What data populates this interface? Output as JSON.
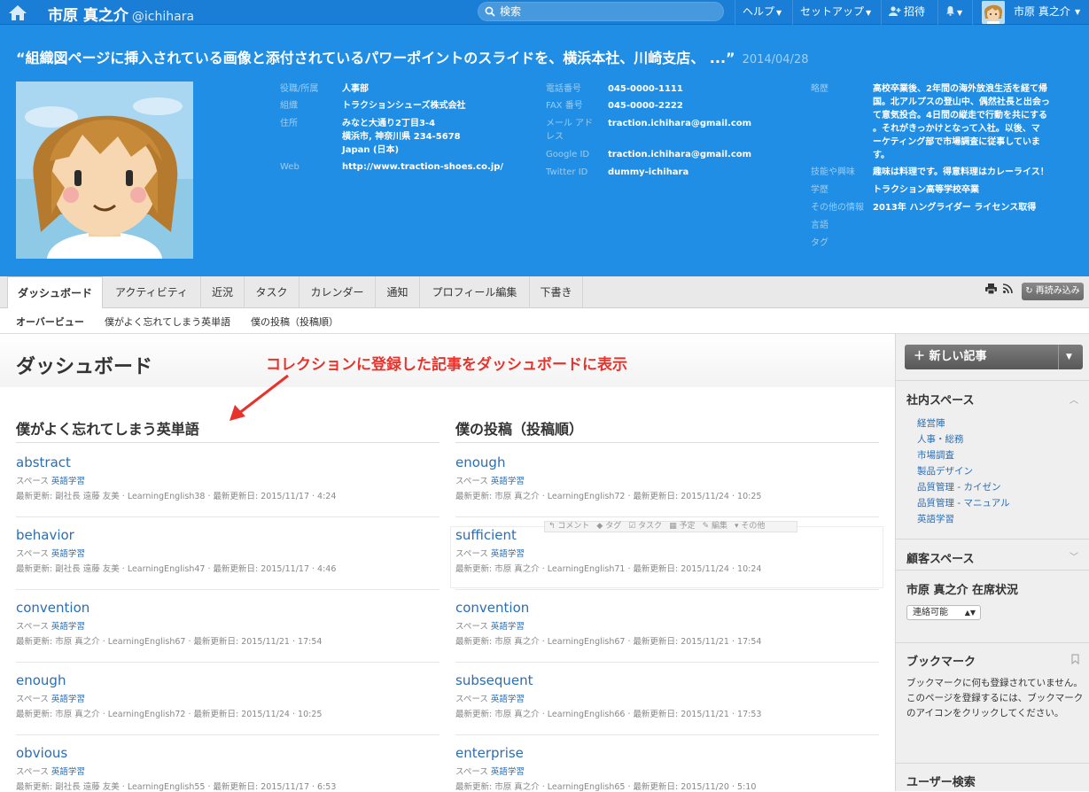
{
  "topbar": {
    "user_name": "市原 真之介",
    "user_id": "@ichihara",
    "search_placeholder": "検索",
    "menus": {
      "help": "ヘルプ",
      "setup": "セットアップ",
      "invite": "招待"
    },
    "account_name": "市原 真之介"
  },
  "hero": {
    "quote": "“組織図ページに挿入されている画像と添付されているパワーポイントのスライドを、横浜本社、川崎支店、 ...”",
    "quote_date": "2014/04/28",
    "col1": {
      "position_label": "役職/所属",
      "position_value": "人事部",
      "org_label": "組織",
      "org_value": "トラクションシューズ株式会社",
      "address_label": "住所",
      "address_line1": "みなと大通り2丁目3-4",
      "address_line2": "横浜市, 神奈川県 234-5678",
      "address_line3": "Japan (日本)",
      "web_label": "Web",
      "web_value": "http://www.traction-shoes.co.jp/"
    },
    "col2": {
      "phone_label": "電話番号",
      "phone_value": "045-0000-1111",
      "fax_label": "FAX 番号",
      "fax_value": "045-0000-2222",
      "mail_label_1": "メール アド",
      "mail_label_2": "レス",
      "mail_value": "traction.ichihara@gmail.com",
      "google_label": "Google ID",
      "google_value": "traction.ichihara@gmail.com",
      "twitter_label": "Twitter ID",
      "twitter_value": "dummy-ichihara"
    },
    "col3": {
      "bio_label": "略歴",
      "bio_lines": [
        "高校卒業後、2年間の海外放浪生活を経て帰",
        "国。北アルプスの登山中、偶然社長と出会っ",
        "て意気投合。4日間の縦走で行動を共にする",
        "。それがきっかけとなって入社。以後、マ",
        "ーケティング部で市場調査に従事していま",
        "す。"
      ],
      "skills_label": "技能や興味",
      "skills_value": "趣味は料理です。得意料理はカレーライス！",
      "edu_label": "学歴",
      "edu_value": "トラクション高等学校卒業",
      "other_label": "その他の情報",
      "other_value": "2013年 ハングライダー ライセンス取得",
      "lang_label": "言語",
      "tag_label": "タグ"
    }
  },
  "tabs": [
    "ダッシュボード",
    "アクティビティ",
    "近況",
    "タスク",
    "カレンダー",
    "通知",
    "プロフィール編集",
    "下書き"
  ],
  "reload_label": "再読み込み",
  "subnav": [
    "オーバービュー",
    "僕がよく忘れてしまう英単語",
    "僕の投稿（投稿順）"
  ],
  "main": {
    "title": "ダッシュボード",
    "annotation": "コレクションに登録した記事をダッシュボードに表示",
    "left_title": "僕がよく忘れてしまう英単語",
    "right_title": "僕の投稿（投稿順）",
    "space_prefix": "スペース",
    "left_articles": [
      {
        "title": "abstract",
        "space": "英語学習",
        "meta": "最新更新: 副社長 遠藤 友美 · LearningEnglish38 · 最新更新日: 2015/11/17 · 4:24"
      },
      {
        "title": "behavior",
        "space": "英語学習",
        "meta": "最新更新: 副社長 遠藤 友美 · LearningEnglish47 · 最新更新日: 2015/11/17 · 4:46"
      },
      {
        "title": "convention",
        "space": "英語学習",
        "meta": "最新更新: 市原 真之介 · LearningEnglish67 · 最新更新日: 2015/11/21 · 17:54"
      },
      {
        "title": "enough",
        "space": "英語学習",
        "meta": "最新更新: 市原 真之介 · LearningEnglish72 · 最新更新日: 2015/11/24 · 10:25"
      },
      {
        "title": "obvious",
        "space": "英語学習",
        "meta": "最新更新: 副社長 遠藤 友美 · LearningEnglish55 · 最新更新日: 2015/11/17 · 6:53"
      }
    ],
    "right_articles": [
      {
        "title": "enough",
        "space": "英語学習",
        "meta": "最新更新: 市原 真之介 · LearningEnglish72 · 最新更新日: 2015/11/24 · 10:25"
      },
      {
        "title": "sufficient",
        "space": "英語学習",
        "meta": "最新更新: 市原 真之介 · LearningEnglish71 · 最新更新日: 2015/11/24 · 10:24"
      },
      {
        "title": "convention",
        "space": "英語学習",
        "meta": "最新更新: 市原 真之介 · LearningEnglish67 · 最新更新日: 2015/11/21 · 17:54"
      },
      {
        "title": "subsequent",
        "space": "英語学習",
        "meta": "最新更新: 市原 真之介 · LearningEnglish66 · 最新更新日: 2015/11/21 · 17:53"
      },
      {
        "title": "enterprise",
        "space": "英語学習",
        "meta": "最新更新: 市原 真之介 · LearningEnglish65 · 最新更新日: 2015/11/20 · 5:10"
      }
    ],
    "hover_actions": [
      "コメント",
      "タグ",
      "タスク",
      "予定",
      "編集",
      "その他"
    ]
  },
  "sidebar": {
    "new_article": "新しい記事",
    "internal_title": "社内スペース",
    "internal_items": [
      "経営陣",
      "人事・総務",
      "市場調査",
      "製品デザイン",
      "品質管理 - カイゼン",
      "品質管理 - マニュアル",
      "英語学習"
    ],
    "customer_title": "顧客スペース",
    "presence_title": "市原 真之介 在席状況",
    "presence_value": "連絡可能",
    "bookmark_title": "ブックマーク",
    "bookmark_text": "ブックマークに何も登録されていません。このページを登録するには、ブックマークのアイコンをクリックしてください。",
    "user_search_title": "ユーザー検索"
  },
  "colors": {
    "topbar": "#1a7ed6",
    "hero": "#1f8ee4",
    "link": "#2a6eb4",
    "annotation": "#e8322c"
  }
}
